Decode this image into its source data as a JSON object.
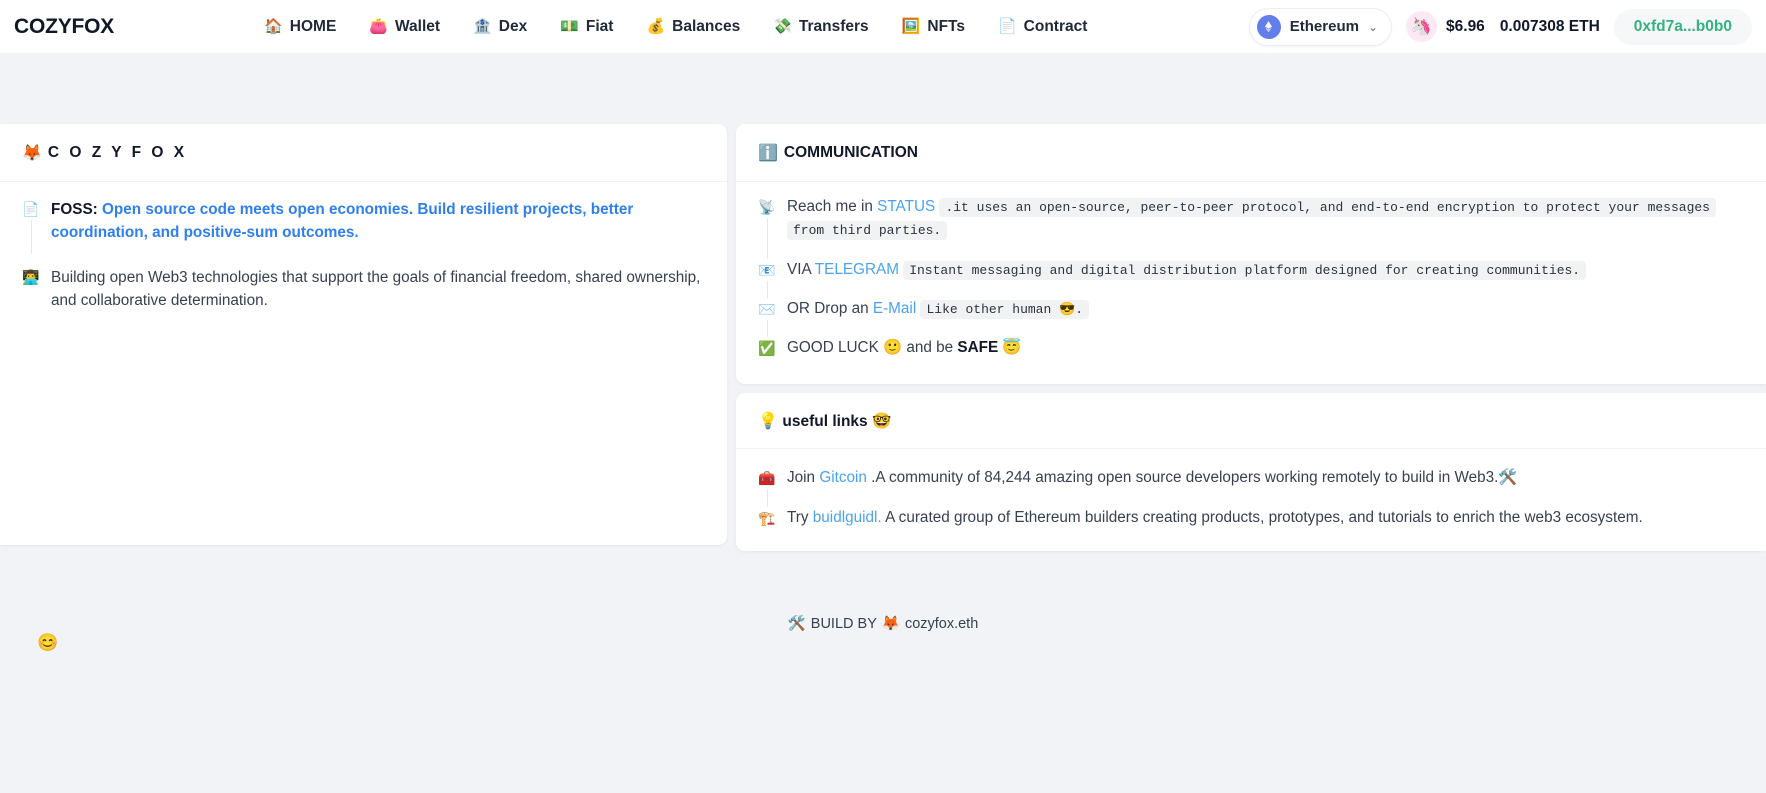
{
  "navbar": {
    "brand": "COZYFOX",
    "links": [
      {
        "icon": "🏠",
        "icon_name": "house-icon",
        "label": "HOME"
      },
      {
        "icon": "👛",
        "icon_name": "purse-icon",
        "label": "Wallet"
      },
      {
        "icon": "🏦",
        "icon_name": "bank-icon",
        "label": "Dex"
      },
      {
        "icon": "💵",
        "icon_name": "banknote-icon",
        "label": "Fiat"
      },
      {
        "icon": "💰",
        "icon_name": "moneybag-icon",
        "label": "Balances"
      },
      {
        "icon": "💸",
        "icon_name": "money-wings-icon",
        "label": "Transfers"
      },
      {
        "icon": "🖼️",
        "icon_name": "framed-picture-icon",
        "label": "NFTs"
      },
      {
        "icon": "📄",
        "icon_name": "page-icon",
        "label": "Contract"
      }
    ],
    "chain_selector": {
      "name": "Ethereum",
      "chevron": "⌄",
      "accent": "#627eea"
    },
    "balance": {
      "unicorn_icon": "🦄",
      "usd": "$6.96",
      "eth": "0.007308 ETH"
    },
    "address": "0xfd7a...b0b0",
    "address_color": "#34b37e"
  },
  "left_card": {
    "title_icon": "🦊",
    "title": "C O Z Y F O X",
    "bullets": [
      {
        "icon": "📄",
        "icon_name": "page-icon",
        "label": "FOSS:",
        "link": "Open source code meets open economies. Build resilient projects, better coordination, and positive-sum outcomes."
      },
      {
        "icon": "👨‍💻",
        "icon_name": "developer-icon",
        "text": "Building open Web3 technologies that support the goals of financial freedom, shared ownership, and collaborative determination."
      }
    ]
  },
  "communication_card": {
    "title_icon": "ℹ️",
    "title": "COMMUNICATION",
    "rows": [
      {
        "icon": "📡",
        "icon_name": "satellite-antenna-icon",
        "prefix": "Reach me in ",
        "link": "STATUS",
        "code": ".it uses an open-source, peer-to-peer protocol, and end-to-end encryption to protect your messages from third parties."
      },
      {
        "icon": "📧",
        "icon_name": "email-icon",
        "prefix": "VIA ",
        "link": "TELEGRAM",
        "code": "Instant messaging and digital distribution platform designed for creating communities."
      },
      {
        "icon": "✉️",
        "icon_name": "envelope-icon",
        "prefix": "OR Drop an ",
        "link": "E-Mail",
        "code": "Like other human 😎."
      },
      {
        "icon": "✅",
        "icon_name": "check-mark-icon",
        "prefix": "GOOD LUCK 🙂 and be ",
        "strong": "SAFE",
        "suffix": " 😇"
      }
    ]
  },
  "links_card": {
    "title_icon": "💡",
    "title": "useful links 🤓",
    "rows": [
      {
        "icon": "🧰",
        "icon_name": "toolbox-icon",
        "prefix": "Join ",
        "link": "Gitcoin",
        "suffix": " .A community of 84,244 amazing open source developers working remotely to build in Web3.🛠️"
      },
      {
        "icon": "🏗️",
        "icon_name": "construction-icon",
        "prefix": "Try ",
        "link": "buidlguidl.",
        "suffix": " A curated group of Ethereum builders creating products, prototypes, and tutorials to enrich the web3 ecosystem."
      }
    ]
  },
  "footer": {
    "tools_icon": "🛠️",
    "text": "BUILD BY",
    "fox_icon": "🦊",
    "author": "cozyfox.eth"
  },
  "corner": {
    "emoji": "😊"
  }
}
